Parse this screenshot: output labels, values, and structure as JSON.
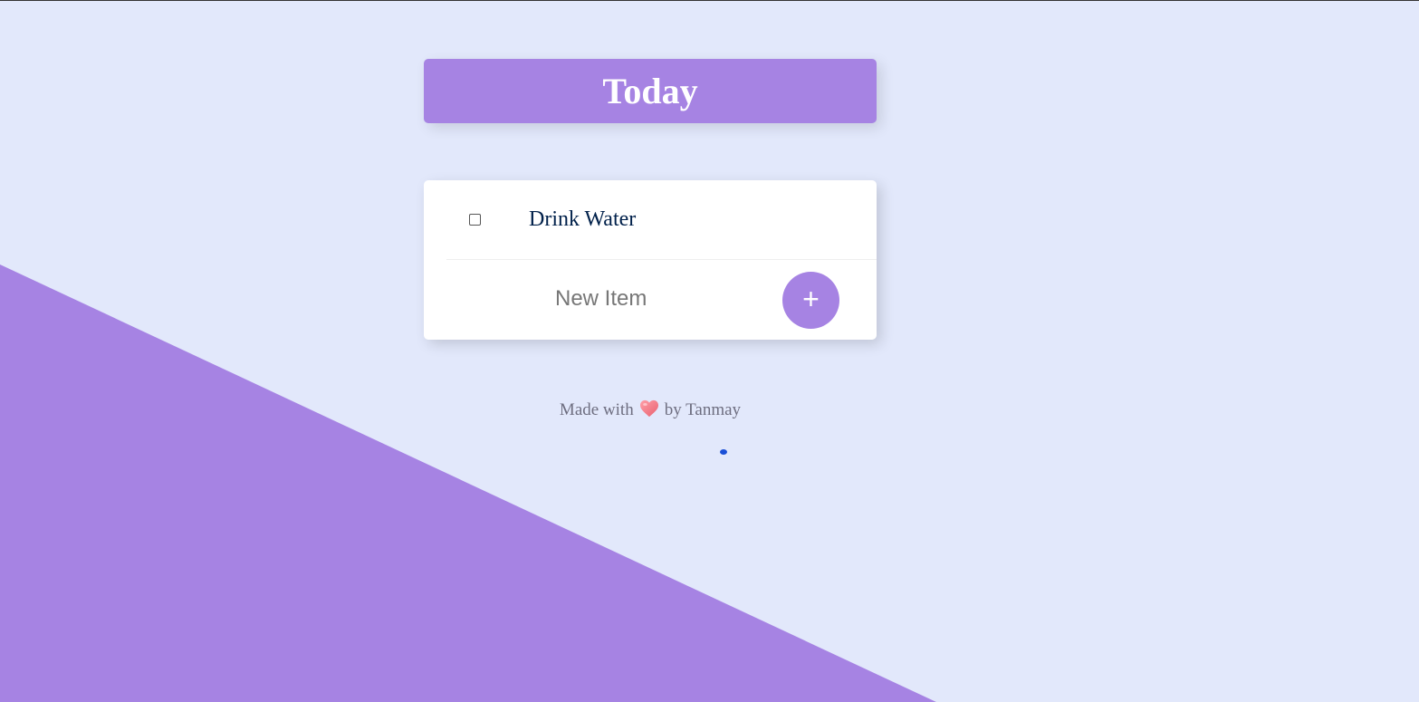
{
  "colors": {
    "background": "#e2e8fb",
    "accent": "#a683e3",
    "text_dark": "#00204a",
    "footer_text": "#6e6e80"
  },
  "heading": {
    "title": "Today"
  },
  "items": [
    {
      "label": "Drink Water",
      "checked": false
    }
  ],
  "form": {
    "input_placeholder": "New Item",
    "input_value": "",
    "add_button_label": "+"
  },
  "footer": {
    "prefix": "Made with",
    "icon": "heart-icon",
    "suffix": "by Tanmay"
  }
}
